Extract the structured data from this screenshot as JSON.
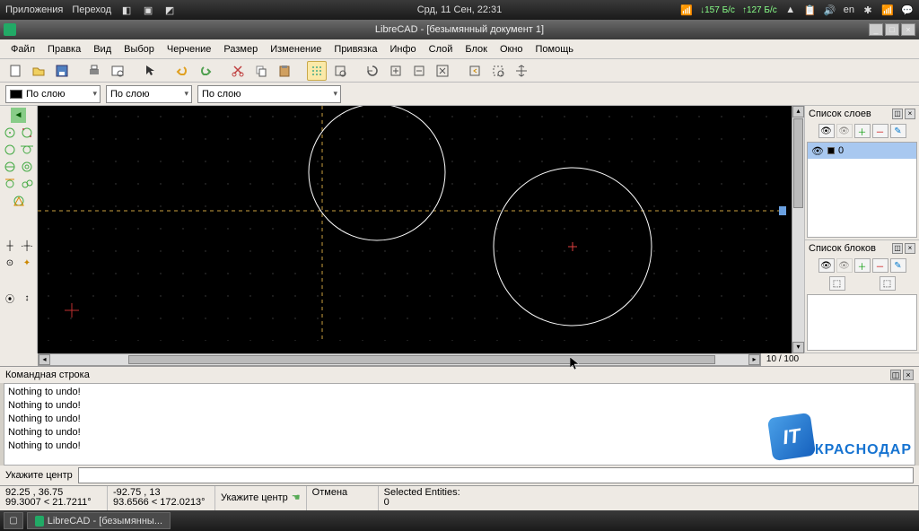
{
  "topbar": {
    "apps": "Приложения",
    "go": "Переход",
    "clock": "Срд, 11 Сен, 22:31",
    "net_down": "↓157 Б/с",
    "net_up": "↑127 Б/с",
    "lang": "en"
  },
  "window": {
    "title": "LibreCAD - [безымянный документ 1]"
  },
  "menu": {
    "file": "Файл",
    "edit": "Правка",
    "view": "Вид",
    "select": "Выбор",
    "draw": "Черчение",
    "dimension": "Размер",
    "modify": "Изменение",
    "snap": "Привязка",
    "info": "Инфо",
    "layer": "Слой",
    "block": "Блок",
    "window": "Окно",
    "help": "Помощь"
  },
  "props": {
    "layer": "По слою",
    "line": "По слою",
    "ltype": "По слою"
  },
  "ratio": "10 / 100",
  "layers": {
    "title": "Список слоев",
    "items": [
      {
        "name": "0"
      }
    ]
  },
  "blocks": {
    "title": "Список блоков"
  },
  "cmd": {
    "title": "Командная строка",
    "lines": [
      "Nothing to undo!",
      "Nothing to undo!",
      "Nothing to undo!",
      "Nothing to undo!",
      "Nothing to undo!"
    ],
    "prompt": "Укажите центр"
  },
  "status": {
    "c1a": "92.25 , 36.75",
    "c1b": "99.3007 < 21.7211°",
    "c2a": "-92.75 , 13",
    "c2b": "93.6566 < 172.0213°",
    "hint": "Укажите центр",
    "cancel": "Отмена",
    "sel": "Selected Entities:",
    "seln": "0"
  },
  "task": {
    "app": "LibreCAD - [безымянны..."
  },
  "logo": {
    "badge": "IT",
    "text": "КРАСНОДАР"
  }
}
